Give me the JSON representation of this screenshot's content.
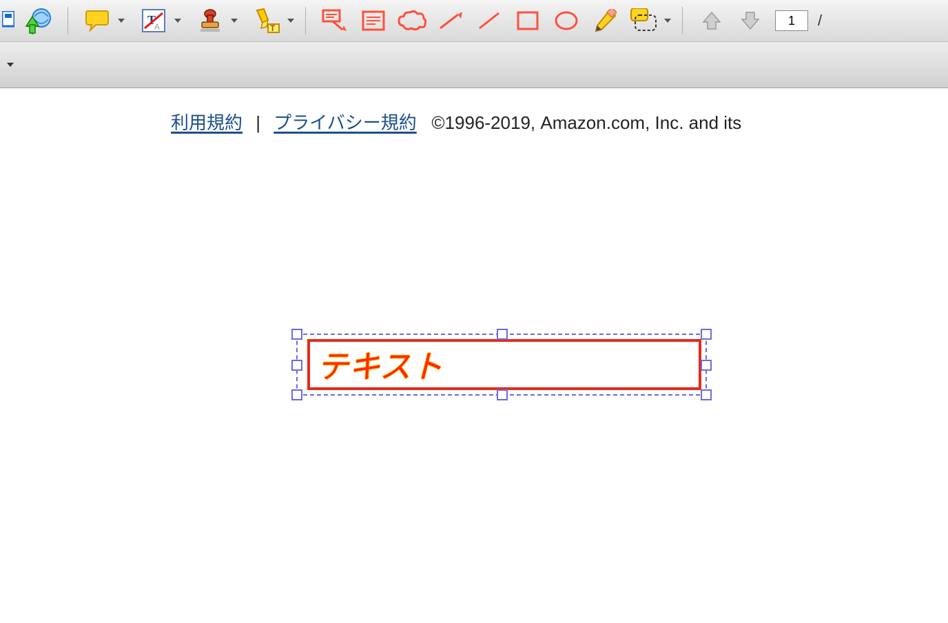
{
  "toolbar": {
    "page_number": "1",
    "page_separator": "/"
  },
  "footer": {
    "terms_link": "利用規約",
    "separator": "|",
    "privacy_link": "プライバシー規約",
    "copyright": "©1996-2019, Amazon.com, Inc. and its"
  },
  "annotation": {
    "textbox_value": "テキスト"
  },
  "icons": {
    "screen": "screen-icon",
    "globe_up": "globe-upload-icon",
    "comment": "comment-icon",
    "text_style": "text-style-icon",
    "stamp": "stamp-icon",
    "highlighter": "highlighter-icon",
    "callout": "callout-icon",
    "textbox": "textbox-icon",
    "cloud": "cloud-icon",
    "arrow": "arrow-icon",
    "line": "line-icon",
    "rect": "rectangle-icon",
    "ellipse": "ellipse-icon",
    "pencil": "pencil-icon",
    "lasso_comment": "lasso-comment-icon",
    "up": "nav-up-icon",
    "down": "nav-down-icon"
  }
}
